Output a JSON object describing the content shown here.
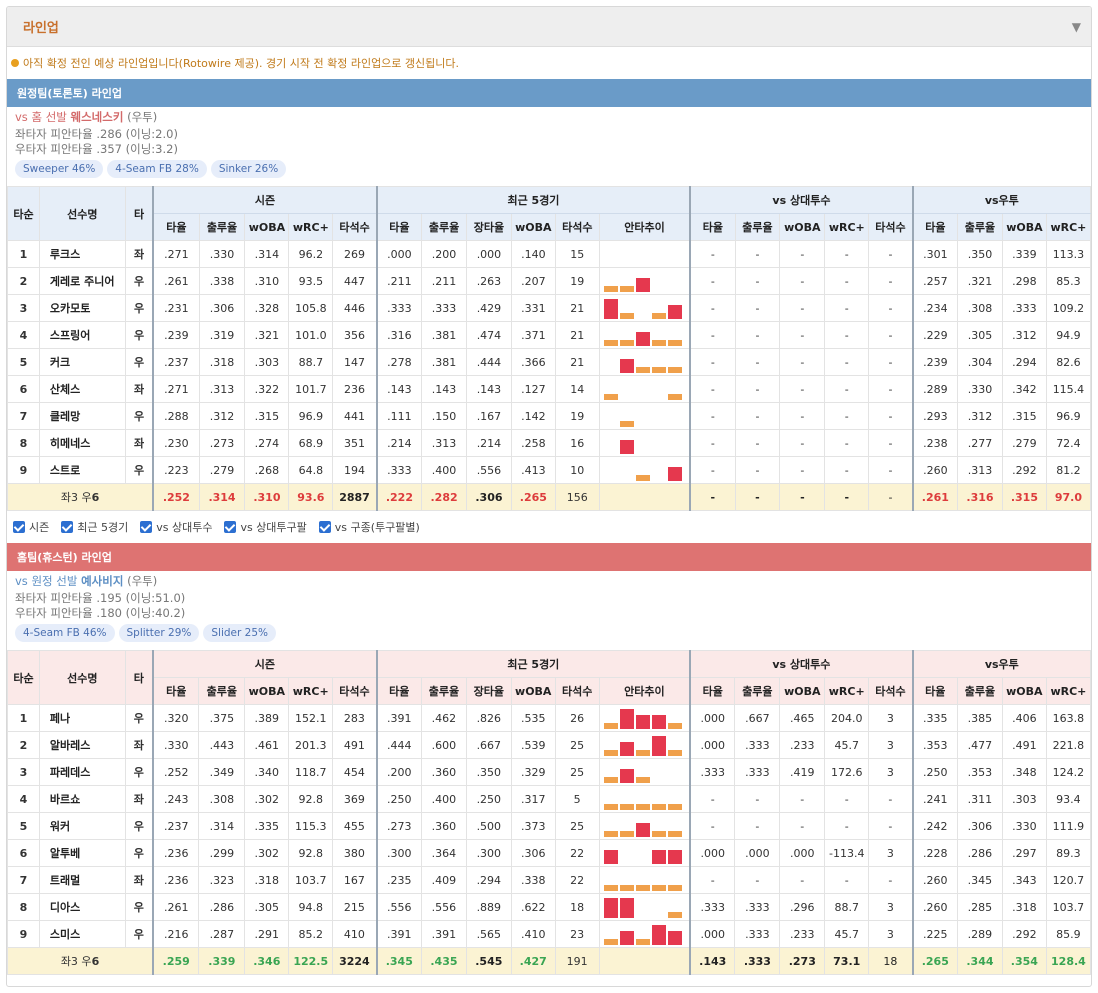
{
  "header": {
    "title": "라인업"
  },
  "notice": "아직 확정 전인 예상 라인업입니다(Rotowire 제공). 경기 시작 전 확정 라인업으로 갱신됩니다.",
  "columns": {
    "order": "타순",
    "name": "선수명",
    "hand": "타",
    "groups": [
      "시즌",
      "최근 5경기",
      "vs 상대투수",
      "vs우투"
    ],
    "season": [
      "타율",
      "출루율",
      "wOBA",
      "wRC+",
      "타석수"
    ],
    "recent": [
      "타율",
      "출루율",
      "장타율",
      "wOBA",
      "타석수",
      "안타추이"
    ],
    "vspitcher": [
      "타율",
      "출루율",
      "wOBA",
      "wRC+",
      "타석수"
    ],
    "vshand": [
      "타율",
      "출루율",
      "wOBA",
      "wRC+"
    ]
  },
  "away": {
    "title": "원정팀(토론토) 라인업",
    "pitcher": {
      "prefix": "vs 홈 선발 ",
      "name": "웨스네스키",
      "hand": " (우투)"
    },
    "vs_left": "좌타자 피안타율 .286 (이닝:2.0)",
    "vs_right": "우타자 피안타율 .357 (이닝:3.2)",
    "pitches": [
      "Sweeper 46%",
      "4-Seam FB 28%",
      "Sinker 26%"
    ],
    "rows": [
      {
        "o": "1",
        "n": "루크스",
        "h": "좌",
        "s": [
          ".271",
          ".330",
          ".314",
          "96.2",
          "269"
        ],
        "r": [
          ".000",
          ".200",
          ".000",
          ".140",
          "15"
        ],
        "t": [
          0,
          0,
          0,
          0,
          0
        ],
        "p": [
          "-",
          "-",
          "-",
          "-",
          "-"
        ],
        "v": [
          ".301",
          ".350",
          ".339",
          "113.3"
        ]
      },
      {
        "o": "2",
        "n": "게레로 주니어",
        "h": "우",
        "s": [
          ".261",
          ".338",
          ".310",
          "93.5",
          "447"
        ],
        "r": [
          ".211",
          ".211",
          ".263",
          ".207",
          "19"
        ],
        "t": [
          1,
          1,
          2,
          0,
          0
        ],
        "p": [
          "-",
          "-",
          "-",
          "-",
          "-"
        ],
        "v": [
          ".257",
          ".321",
          ".298",
          "85.3"
        ]
      },
      {
        "o": "3",
        "n": "오카모토",
        "h": "우",
        "s": [
          ".231",
          ".306",
          ".328",
          "105.8",
          "446"
        ],
        "r": [
          ".333",
          ".333",
          ".429",
          ".331",
          "21"
        ],
        "t": [
          3,
          1,
          0,
          1,
          2
        ],
        "p": [
          "-",
          "-",
          "-",
          "-",
          "-"
        ],
        "v": [
          ".234",
          ".308",
          ".333",
          "109.2"
        ]
      },
      {
        "o": "4",
        "n": "스프링어",
        "h": "우",
        "s": [
          ".239",
          ".319",
          ".321",
          "101.0",
          "356"
        ],
        "r": [
          ".316",
          ".381",
          ".474",
          ".371",
          "21"
        ],
        "t": [
          1,
          1,
          2,
          1,
          1
        ],
        "p": [
          "-",
          "-",
          "-",
          "-",
          "-"
        ],
        "v": [
          ".229",
          ".305",
          ".312",
          "94.9"
        ]
      },
      {
        "o": "5",
        "n": "커크",
        "h": "우",
        "s": [
          ".237",
          ".318",
          ".303",
          "88.7",
          "147"
        ],
        "r": [
          ".278",
          ".381",
          ".444",
          ".366",
          "21"
        ],
        "t": [
          0,
          2,
          1,
          1,
          1
        ],
        "p": [
          "-",
          "-",
          "-",
          "-",
          "-"
        ],
        "v": [
          ".239",
          ".304",
          ".294",
          "82.6"
        ]
      },
      {
        "o": "6",
        "n": "산체스",
        "h": "좌",
        "s": [
          ".271",
          ".313",
          ".322",
          "101.7",
          "236"
        ],
        "r": [
          ".143",
          ".143",
          ".143",
          ".127",
          "14"
        ],
        "t": [
          1,
          0,
          0,
          0,
          1
        ],
        "p": [
          "-",
          "-",
          "-",
          "-",
          "-"
        ],
        "v": [
          ".289",
          ".330",
          ".342",
          "115.4"
        ]
      },
      {
        "o": "7",
        "n": "클레망",
        "h": "우",
        "s": [
          ".288",
          ".312",
          ".315",
          "96.9",
          "441"
        ],
        "r": [
          ".111",
          ".150",
          ".167",
          ".142",
          "19"
        ],
        "t": [
          0,
          1,
          0,
          0,
          0
        ],
        "p": [
          "-",
          "-",
          "-",
          "-",
          "-"
        ],
        "v": [
          ".293",
          ".312",
          ".315",
          "96.9"
        ]
      },
      {
        "o": "8",
        "n": "히메네스",
        "h": "좌",
        "s": [
          ".230",
          ".273",
          ".274",
          "68.9",
          "351"
        ],
        "r": [
          ".214",
          ".313",
          ".214",
          ".258",
          "16"
        ],
        "t": [
          0,
          2,
          0,
          0,
          0
        ],
        "p": [
          "-",
          "-",
          "-",
          "-",
          "-"
        ],
        "v": [
          ".238",
          ".277",
          ".279",
          "72.4"
        ]
      },
      {
        "o": "9",
        "n": "스트로",
        "h": "우",
        "s": [
          ".223",
          ".279",
          ".268",
          "64.8",
          "194"
        ],
        "r": [
          ".333",
          ".400",
          ".556",
          ".413",
          "10"
        ],
        "t": [
          0,
          0,
          1,
          0,
          2
        ],
        "p": [
          "-",
          "-",
          "-",
          "-",
          "-"
        ],
        "v": [
          ".260",
          ".313",
          ".292",
          "81.2"
        ]
      }
    ],
    "total": {
      "label_a": "좌3 우",
      "label_b": "6",
      "s": [
        ".252",
        ".314",
        ".310",
        "93.6",
        "2887"
      ],
      "r": [
        ".222",
        ".282",
        ".306",
        ".265",
        "156"
      ],
      "p": [
        "-",
        "-",
        "-",
        "-",
        "-"
      ],
      "v": [
        ".261",
        ".316",
        ".315",
        "97.0"
      ]
    }
  },
  "checkboxes": [
    "시즌",
    "최근 5경기",
    "vs 상대투수",
    "vs 상대투구팔",
    "vs 구종(투구팔별)"
  ],
  "home": {
    "title": "홈팀(휴스턴) 라인업",
    "pitcher": {
      "prefix": "vs 원정 선발 ",
      "name": "예사비지",
      "hand": " (우투)"
    },
    "vs_left": "좌타자 피안타율 .195 (이닝:51.0)",
    "vs_right": "우타자 피안타율 .180 (이닝:40.2)",
    "pitches": [
      "4-Seam FB 46%",
      "Splitter 29%",
      "Slider 25%"
    ],
    "rows": [
      {
        "o": "1",
        "n": "페나",
        "h": "우",
        "s": [
          ".320",
          ".375",
          ".389",
          "152.1",
          "283"
        ],
        "r": [
          ".391",
          ".462",
          ".826",
          ".535",
          "26"
        ],
        "t": [
          1,
          3,
          2,
          2,
          1
        ],
        "p": [
          ".000",
          ".667",
          ".465",
          "204.0",
          "3"
        ],
        "v": [
          ".335",
          ".385",
          ".406",
          "163.8"
        ]
      },
      {
        "o": "2",
        "n": "알바레스",
        "h": "좌",
        "s": [
          ".330",
          ".443",
          ".461",
          "201.3",
          "491"
        ],
        "r": [
          ".444",
          ".600",
          ".667",
          ".539",
          "25"
        ],
        "t": [
          1,
          2,
          1,
          3,
          1
        ],
        "p": [
          ".000",
          ".333",
          ".233",
          "45.7",
          "3"
        ],
        "v": [
          ".353",
          ".477",
          ".491",
          "221.8"
        ]
      },
      {
        "o": "3",
        "n": "파레데스",
        "h": "우",
        "s": [
          ".252",
          ".349",
          ".340",
          "118.7",
          "454"
        ],
        "r": [
          ".200",
          ".360",
          ".350",
          ".329",
          "25"
        ],
        "t": [
          1,
          2,
          1,
          0,
          0
        ],
        "p": [
          ".333",
          ".333",
          ".419",
          "172.6",
          "3"
        ],
        "v": [
          ".250",
          ".353",
          ".348",
          "124.2"
        ]
      },
      {
        "o": "4",
        "n": "바르쇼",
        "h": "좌",
        "s": [
          ".243",
          ".308",
          ".302",
          "92.8",
          "369"
        ],
        "r": [
          ".250",
          ".400",
          ".250",
          ".317",
          "5"
        ],
        "t": [
          1,
          1,
          1,
          1,
          1
        ],
        "p": [
          "-",
          "-",
          "-",
          "-",
          "-"
        ],
        "v": [
          ".241",
          ".311",
          ".303",
          "93.4"
        ]
      },
      {
        "o": "5",
        "n": "워커",
        "h": "우",
        "s": [
          ".237",
          ".314",
          ".335",
          "115.3",
          "455"
        ],
        "r": [
          ".273",
          ".360",
          ".500",
          ".373",
          "25"
        ],
        "t": [
          1,
          1,
          2,
          1,
          1
        ],
        "p": [
          "-",
          "-",
          "-",
          "-",
          "-"
        ],
        "v": [
          ".242",
          ".306",
          ".330",
          "111.9"
        ]
      },
      {
        "o": "6",
        "n": "알투베",
        "h": "우",
        "s": [
          ".236",
          ".299",
          ".302",
          "92.8",
          "380"
        ],
        "r": [
          ".300",
          ".364",
          ".300",
          ".306",
          "22"
        ],
        "t": [
          2,
          0,
          0,
          2,
          2
        ],
        "p": [
          ".000",
          ".000",
          ".000",
          "-113.4",
          "3"
        ],
        "v": [
          ".228",
          ".286",
          ".297",
          "89.3"
        ]
      },
      {
        "o": "7",
        "n": "트래멀",
        "h": "좌",
        "s": [
          ".236",
          ".323",
          ".318",
          "103.7",
          "167"
        ],
        "r": [
          ".235",
          ".409",
          ".294",
          ".338",
          "22"
        ],
        "t": [
          1,
          1,
          1,
          1,
          1
        ],
        "p": [
          "-",
          "-",
          "-",
          "-",
          "-"
        ],
        "v": [
          ".260",
          ".345",
          ".343",
          "120.7"
        ]
      },
      {
        "o": "8",
        "n": "디아스",
        "h": "우",
        "s": [
          ".261",
          ".286",
          ".305",
          "94.8",
          "215"
        ],
        "r": [
          ".556",
          ".556",
          ".889",
          ".622",
          "18"
        ],
        "t": [
          3,
          3,
          0,
          0,
          1
        ],
        "p": [
          ".333",
          ".333",
          ".296",
          "88.7",
          "3"
        ],
        "v": [
          ".260",
          ".285",
          ".318",
          "103.7"
        ]
      },
      {
        "o": "9",
        "n": "스미스",
        "h": "우",
        "s": [
          ".216",
          ".287",
          ".291",
          "85.2",
          "410"
        ],
        "r": [
          ".391",
          ".391",
          ".565",
          ".410",
          "23"
        ],
        "t": [
          1,
          2,
          1,
          3,
          2
        ],
        "p": [
          ".000",
          ".333",
          ".233",
          "45.7",
          "3"
        ],
        "v": [
          ".225",
          ".289",
          ".292",
          "85.9"
        ]
      }
    ],
    "total": {
      "label_a": "좌3 우",
      "label_b": "6",
      "s": [
        ".259",
        ".339",
        ".346",
        "122.5",
        "3224"
      ],
      "r": [
        ".345",
        ".435",
        ".545",
        ".427",
        "191"
      ],
      "p": [
        ".143",
        ".333",
        ".273",
        "73.1",
        "18"
      ],
      "v": [
        ".265",
        ".344",
        ".354",
        "128.4"
      ]
    }
  },
  "colors": {
    "away_band": "#6a9bc8",
    "home_band": "#de7372",
    "hit_single": "#f0a04b",
    "hit_multi": "#e5384e",
    "total_bg": "#fbf3d3",
    "total_red": "#dd3c3c",
    "total_green": "#3aa553"
  }
}
